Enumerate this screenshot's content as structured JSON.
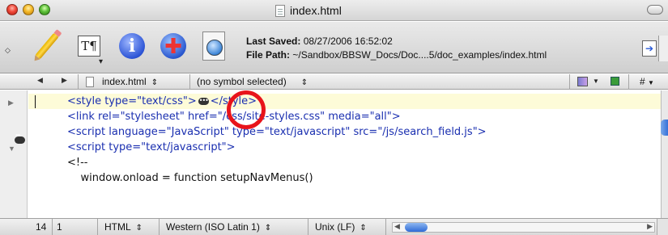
{
  "window": {
    "title": "index.html"
  },
  "toolbar": {
    "last_saved_label": "Last Saved:",
    "last_saved_value": "08/27/2006 16:52:02",
    "file_path_label": "File Path:",
    "file_path_value": "~/Sandbox/BBSW_Docs/Doc....5/doc_examples/index.html",
    "text_options_glyph": "T¶"
  },
  "navbar": {
    "file_menu": "index.html",
    "symbol_menu": "(no symbol selected)",
    "hash_label": "#"
  },
  "editor": {
    "lines": [
      {
        "before": "<style type=\"text/css\">",
        "after": "</style>"
      },
      {
        "text": "<link rel=\"stylesheet\" href=\"/css/site-styles.css\" media=\"all\">"
      },
      {
        "text": "<script language=\"JavaScript\" type=\"text/javascript\" src=\"/js/search_field.js\">"
      },
      {
        "text": "<script type=\"text/javascript\">"
      },
      {
        "text": "<!--"
      },
      {
        "text": "    window.onload = function setupNavMenus()"
      }
    ]
  },
  "statusbar": {
    "line": "14",
    "column": "1",
    "language": "HTML",
    "encoding": "Western (ISO Latin 1)",
    "line_endings": "Unix (LF)"
  },
  "colors": {
    "markup_text": "#1a2fb0",
    "highlight_line": "#fdfbd8",
    "annotation_ring": "#e8141b"
  }
}
